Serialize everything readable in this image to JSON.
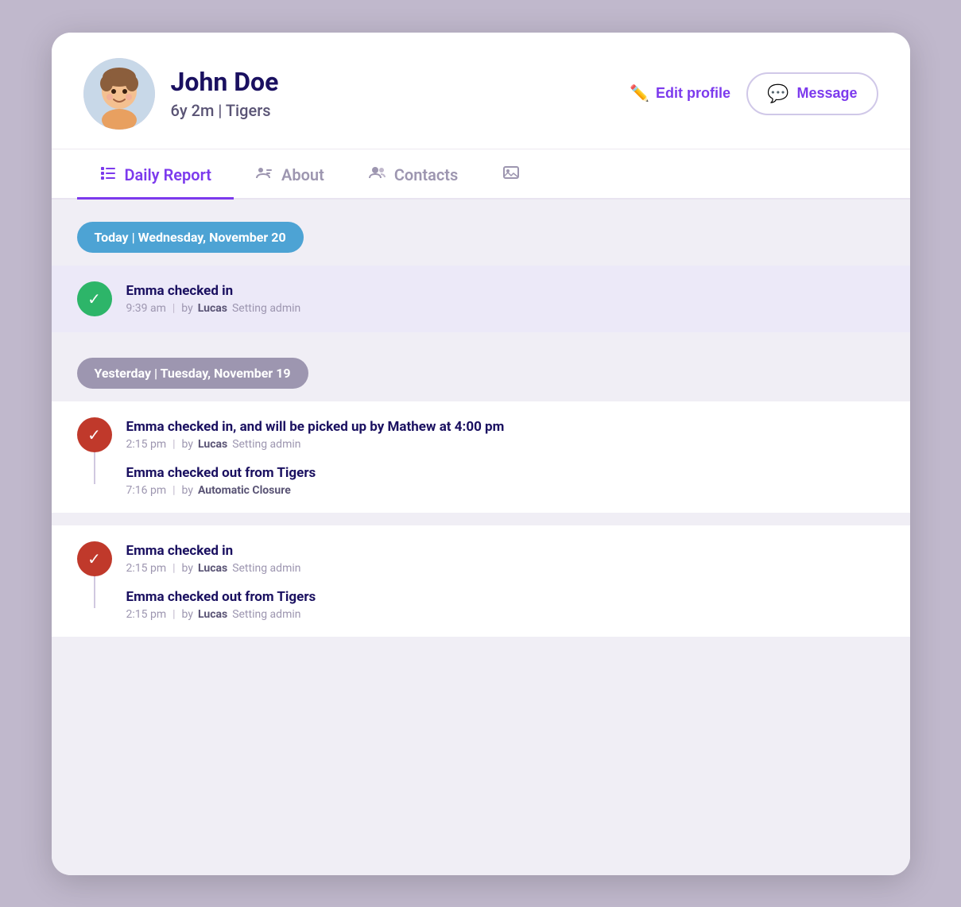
{
  "profile": {
    "name": "John Doe",
    "age_group": "6y 2m | Tigers",
    "edit_label": "Edit profile",
    "message_label": "Message"
  },
  "tabs": [
    {
      "id": "daily-report",
      "label": "Daily Report",
      "active": true
    },
    {
      "id": "about",
      "label": "About",
      "active": false
    },
    {
      "id": "contacts",
      "label": "Contacts",
      "active": false
    },
    {
      "id": "photos",
      "label": "",
      "active": false
    }
  ],
  "daily_report": {
    "today": {
      "badge": "Today | Wednesday, November 20",
      "events": [
        {
          "title": "Emma checked in",
          "time": "9:39 am",
          "by": "Lucas",
          "role": "Setting admin",
          "icon": "check"
        }
      ]
    },
    "yesterday": {
      "badge": "Yesterday | Tuesday, November 19",
      "groups": [
        {
          "icon_color": "red",
          "events": [
            {
              "title": "Emma checked in, and will be picked up by Mathew at 4:00 pm",
              "time": "2:15 pm",
              "by": "Lucas",
              "role": "Setting admin"
            },
            {
              "title": "Emma checked out from Tigers",
              "time": "7:16 pm",
              "by": "Automatic Closure",
              "role": ""
            }
          ]
        },
        {
          "icon_color": "red",
          "events": [
            {
              "title": "Emma checked in",
              "time": "2:15 pm",
              "by": "Lucas",
              "role": "Setting admin"
            },
            {
              "title": "Emma checked out from Tigers",
              "time": "2:15 pm",
              "by": "Lucas",
              "role": "Setting admin"
            }
          ]
        }
      ]
    }
  }
}
